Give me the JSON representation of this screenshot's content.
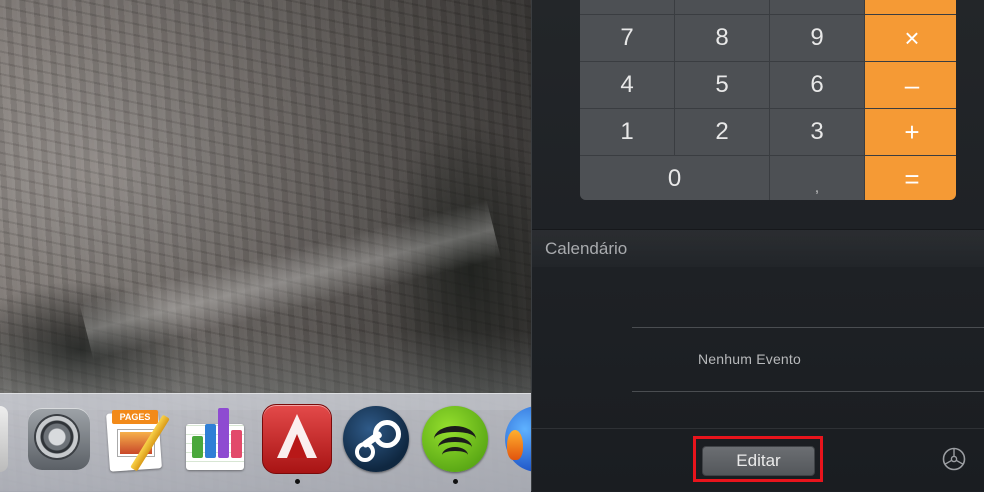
{
  "calculator": {
    "stub_row": [
      "",
      "",
      "",
      ""
    ],
    "rows": [
      [
        "7",
        "8",
        "9",
        "×"
      ],
      [
        "4",
        "5",
        "6",
        "–"
      ],
      [
        "1",
        "2",
        "3",
        "+"
      ]
    ],
    "bottom_row": {
      "zero": "0",
      "decimal": ",",
      "equals": "="
    },
    "operator_color": "#f59a35"
  },
  "calendar": {
    "title": "Calendário",
    "empty_message": "Nenhum Evento"
  },
  "footer": {
    "edit_label": "Editar",
    "settings_icon": "gear-icon",
    "highlight_color": "#e8141c"
  },
  "dock": {
    "apps": [
      {
        "icon": "system-preferences-icon",
        "running": false
      },
      {
        "icon": "pages-icon",
        "running": false
      },
      {
        "icon": "numbers-icon",
        "running": false
      },
      {
        "icon": "autocad-icon",
        "running": true
      },
      {
        "icon": "steam-icon",
        "running": false
      },
      {
        "icon": "spotify-icon",
        "running": true
      }
    ]
  }
}
